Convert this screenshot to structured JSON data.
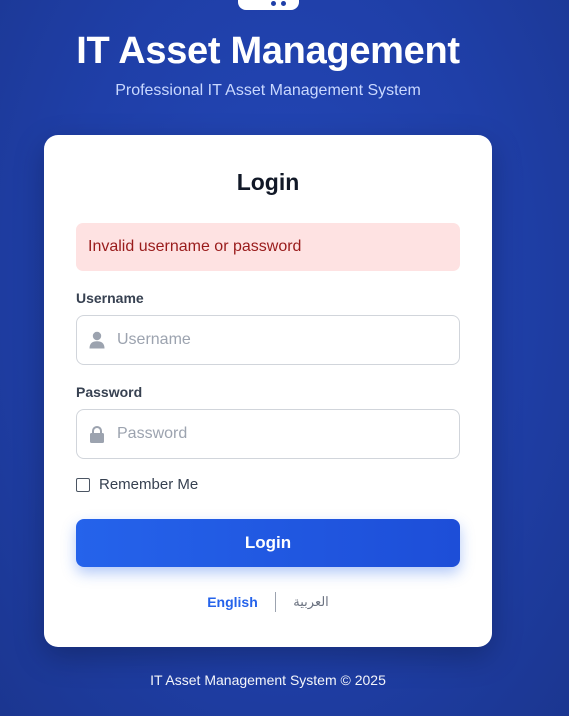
{
  "header": {
    "title": "IT Asset Management",
    "subtitle": "Professional IT Asset Management System"
  },
  "login_card": {
    "title": "Login",
    "error_message": "Invalid username or password",
    "username": {
      "label": "Username",
      "placeholder": "Username",
      "value": "",
      "icon": "user-icon"
    },
    "password": {
      "label": "Password",
      "placeholder": "Password",
      "value": "",
      "icon": "lock-icon"
    },
    "remember_me": {
      "label": "Remember Me",
      "checked": false
    },
    "submit_label": "Login",
    "languages": {
      "english": "English",
      "arabic": "العربية",
      "active": "English"
    }
  },
  "footer": {
    "text": "IT Asset Management System © 2025"
  },
  "colors": {
    "background": "#1f3fa8",
    "primary": "#2563eb",
    "error_bg": "#fee2e2",
    "error_text": "#991b1b"
  }
}
